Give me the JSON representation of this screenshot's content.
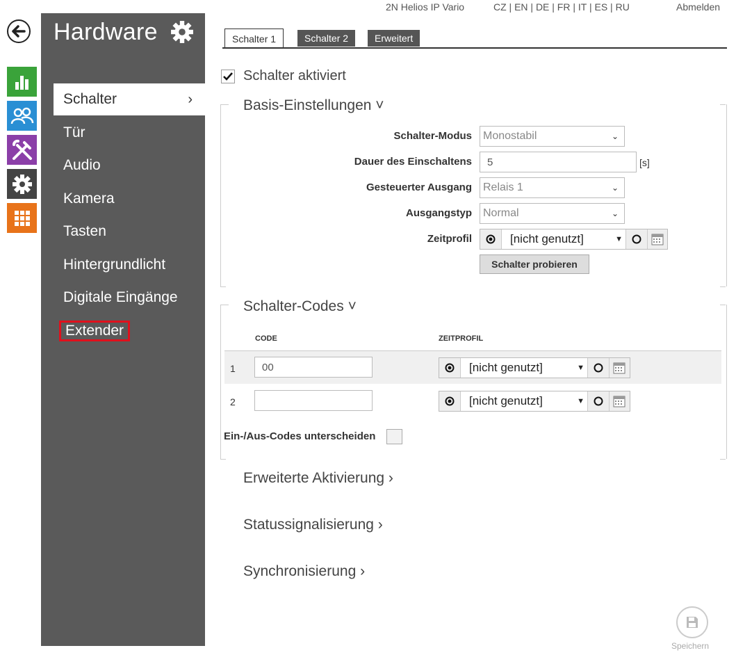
{
  "topbar": {
    "device": "2N Helios IP Vario",
    "languages": "CZ | EN | DE | FR | IT | ES | RU",
    "logout": "Abmelden"
  },
  "rail": {
    "back_icon": "back-arrow-icon",
    "icons": [
      {
        "name": "status-chart-icon",
        "color": "#3aa33a"
      },
      {
        "name": "users-icon",
        "color": "#2a8fd4"
      },
      {
        "name": "hardware-tools-icon",
        "color": "#8b3fa8"
      },
      {
        "name": "services-gear-icon",
        "color": "#444444"
      },
      {
        "name": "system-grid-icon",
        "color": "#e8731a"
      }
    ]
  },
  "sidebar": {
    "title": "Hardware",
    "items": [
      {
        "label": "Schalter",
        "active": true
      },
      {
        "label": "Tür"
      },
      {
        "label": "Audio"
      },
      {
        "label": "Kamera"
      },
      {
        "label": "Tasten"
      },
      {
        "label": "Hintergrundlicht"
      },
      {
        "label": "Digitale Eingänge"
      },
      {
        "label": "Extender",
        "highlighted": true
      }
    ]
  },
  "tabs": [
    {
      "label": "Schalter 1",
      "active": true
    },
    {
      "label": "Schalter 2"
    },
    {
      "label": "Erweitert"
    }
  ],
  "switch_enabled": {
    "label": "Schalter aktiviert",
    "checked": true
  },
  "basic": {
    "title": "Basis-Einstellungen ˅",
    "mode_label": "Schalter-Modus",
    "mode_value": "Monostabil",
    "duration_label": "Dauer des Einschaltens",
    "duration_value": "5",
    "duration_unit": "[s]",
    "output_label": "Gesteuerter Ausgang",
    "output_value": "Relais 1",
    "output_type_label": "Ausgangstyp",
    "output_type_value": "Normal",
    "profile_label": "Zeitprofil",
    "profile_value": "[nicht genutzt]",
    "test_button": "Schalter probieren"
  },
  "codes": {
    "title": "Schalter-Codes ˅",
    "col_code": "CODE",
    "col_profile": "ZEITPROFIL",
    "rows": [
      {
        "index": "1",
        "code": "00",
        "profile": "[nicht genutzt]"
      },
      {
        "index": "2",
        "code": "",
        "profile": "[nicht genutzt]"
      }
    ],
    "distinguish_label": "Ein-/Aus-Codes unterscheiden"
  },
  "sections": {
    "advanced": "Erweiterte Aktivierung ›",
    "status": "Statussignalisierung ›",
    "sync": "Synchronisierung ›"
  },
  "save": {
    "label": "Speichern"
  }
}
